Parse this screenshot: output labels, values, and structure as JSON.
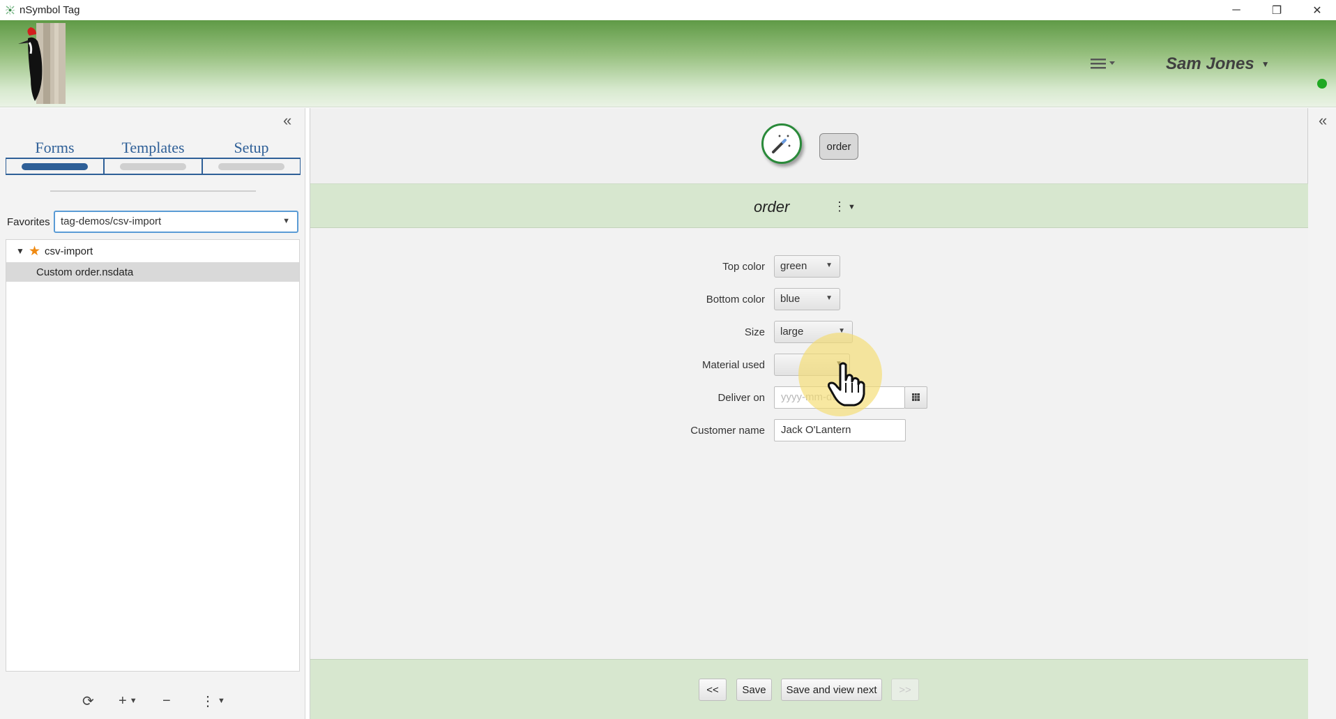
{
  "window": {
    "title": "nSymbol Tag",
    "app_icon": "nsymbol-app-icon",
    "controls": {
      "minimize": "─",
      "maximize": "❐",
      "close": "✕"
    }
  },
  "header": {
    "logo": "woodpecker-logo",
    "menu_icon": "hamburger-menu-icon",
    "user_name": "Sam Jones",
    "status_color": "#1fa823"
  },
  "sidebar": {
    "collapse_glyph": "«",
    "tabs": [
      {
        "label": "Forms",
        "active": true
      },
      {
        "label": "Templates",
        "active": false
      },
      {
        "label": "Setup",
        "active": false
      }
    ],
    "favorites_label": "Favorites",
    "favorites_value": "tag-demos/csv-import",
    "tree": {
      "folder": "csv-import",
      "file": "Custom order.nsdata"
    },
    "tools": {
      "refresh": "⟳",
      "add": "+",
      "remove": "−",
      "more": "⋮"
    }
  },
  "main": {
    "wand_icon": "magic-wand-icon",
    "chip_label": "order",
    "form_title": "order",
    "fields": [
      {
        "label": "Top color",
        "value": "green",
        "kind": "combo"
      },
      {
        "label": "Bottom color",
        "value": "blue",
        "kind": "combo"
      },
      {
        "label": "Size",
        "value": "large",
        "kind": "combo"
      },
      {
        "label": "Material used",
        "value": "",
        "kind": "combo"
      },
      {
        "label": "Deliver on",
        "placeholder": "yyyy-mm-dd",
        "kind": "date"
      },
      {
        "label": "Customer name",
        "value": "Jack O'Lantern",
        "kind": "text"
      }
    ],
    "footer": {
      "prev": "<<",
      "save": "Save",
      "save_next": "Save and view next",
      "next": ">>"
    }
  },
  "right_panel": {
    "collapse_glyph": "«"
  },
  "colors": {
    "accent_blue": "#2e5f97",
    "header_green": "#d7e7cf",
    "star_orange": "#ef8a12"
  }
}
